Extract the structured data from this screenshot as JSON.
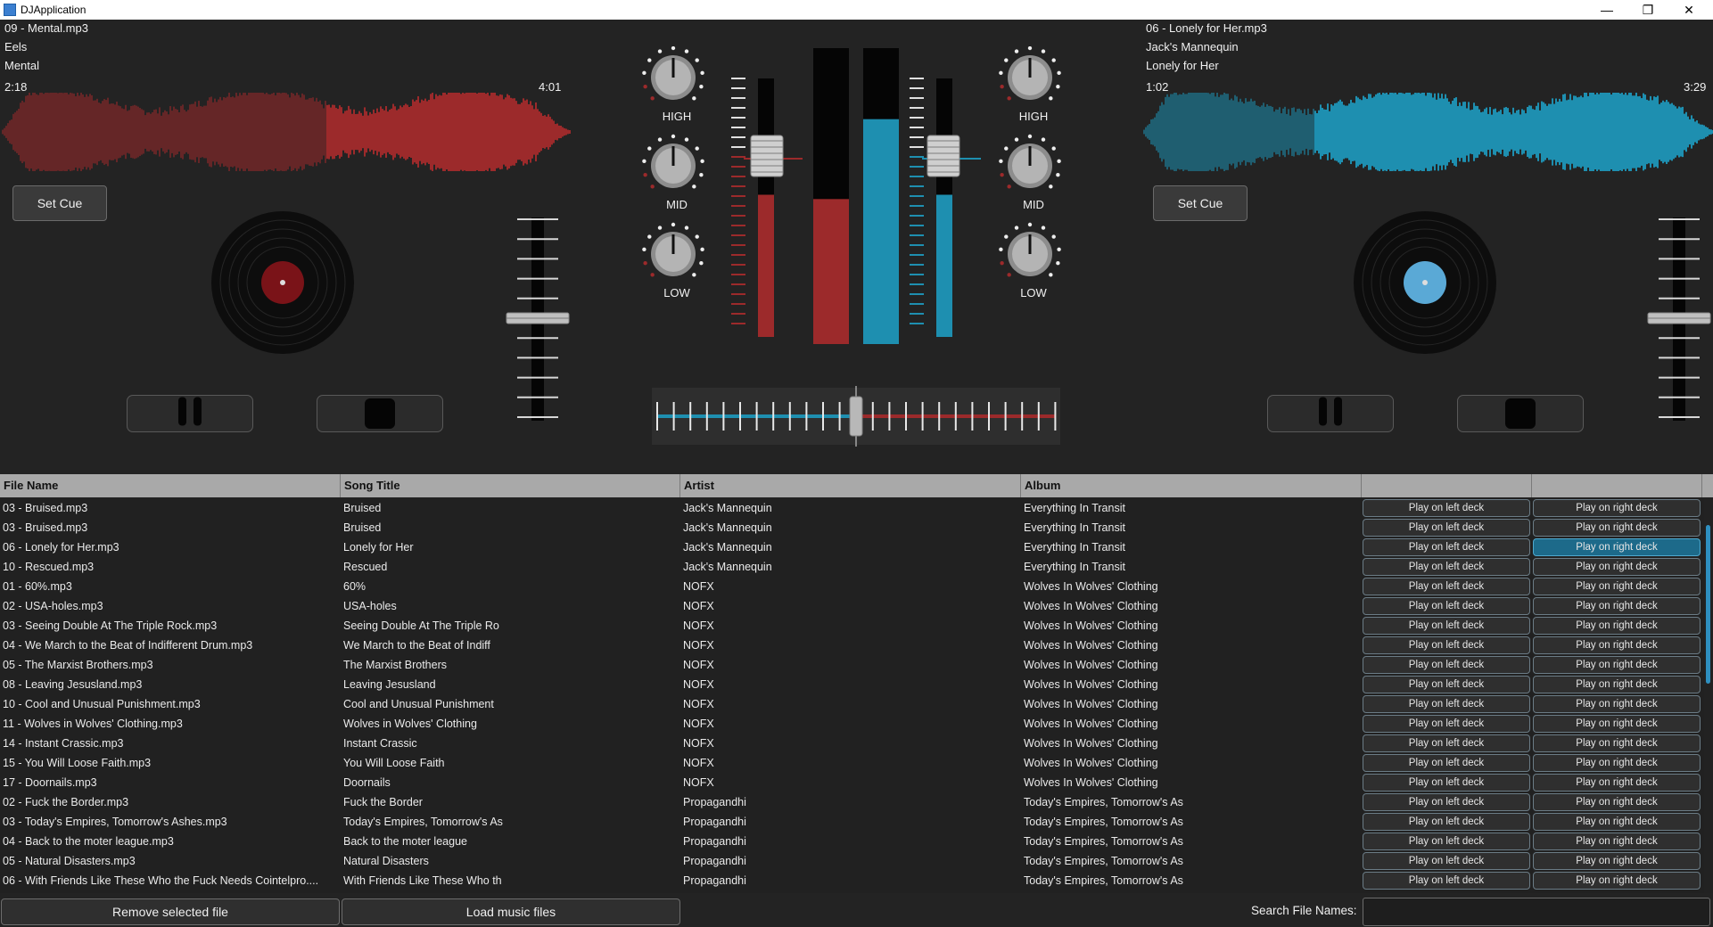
{
  "window": {
    "title": "DJApplication",
    "controls": [
      "—",
      "❐",
      "✕"
    ]
  },
  "left_deck": {
    "file": "09 - Mental.mp3",
    "artist": "Eels",
    "title": "Mental",
    "position": "2:18",
    "duration": "4:01",
    "progress": 0.57,
    "color": "#9c2a2b",
    "set_cue_label": "Set Cue",
    "pitch_level": 0.5
  },
  "right_deck": {
    "file": "06 - Lonely for Her.mp3",
    "artist": "Jack's Mannequin",
    "title": "Lonely for Her",
    "position": "1:02",
    "duration": "3:29",
    "progress": 0.3,
    "color": "#1e8fb0",
    "set_cue_label": "Set Cue",
    "pitch_level": 0.5
  },
  "mixer": {
    "knob_labels": [
      "HIGH",
      "MID",
      "LOW"
    ],
    "left_channel_level": 0.55,
    "right_channel_level": 0.55,
    "left_vu_level": 0.49,
    "right_vu_level": 0.76,
    "crossfader_position": 0.5
  },
  "library": {
    "columns": [
      "File Name",
      "Song Title",
      "Artist",
      "Album",
      "",
      ""
    ],
    "play_left_label": "Play on left deck",
    "play_right_label": "Play on right deck",
    "rows": [
      {
        "file": "03 - Bruised.mp3",
        "song": "Bruised",
        "artist": "Jack's Mannequin",
        "album": "Everything In Transit"
      },
      {
        "file": "03 - Bruised.mp3",
        "song": "Bruised",
        "artist": "Jack's Mannequin",
        "album": "Everything In Transit"
      },
      {
        "file": "06 - Lonely for Her.mp3",
        "song": "Lonely for Her",
        "artist": "Jack's Mannequin",
        "album": "Everything In Transit"
      },
      {
        "file": "10 - Rescued.mp3",
        "song": "Rescued",
        "artist": "Jack's Mannequin",
        "album": "Everything In Transit"
      },
      {
        "file": "01 - 60%.mp3",
        "song": "60%",
        "artist": "NOFX",
        "album": "Wolves In Wolves' Clothing"
      },
      {
        "file": "02 - USA-holes.mp3",
        "song": "USA-holes",
        "artist": "NOFX",
        "album": "Wolves In Wolves' Clothing"
      },
      {
        "file": "03 - Seeing Double At The Triple Rock.mp3",
        "song": "Seeing Double At The Triple Ro",
        "artist": "NOFX",
        "album": "Wolves In Wolves' Clothing"
      },
      {
        "file": "04 - We March to the Beat of Indifferent Drum.mp3",
        "song": "We March to the Beat of Indiff",
        "artist": "NOFX",
        "album": "Wolves In Wolves' Clothing"
      },
      {
        "file": "05 - The Marxist Brothers.mp3",
        "song": "The Marxist Brothers",
        "artist": "NOFX",
        "album": "Wolves In Wolves' Clothing"
      },
      {
        "file": "08 - Leaving Jesusland.mp3",
        "song": "Leaving Jesusland",
        "artist": "NOFX",
        "album": "Wolves In Wolves' Clothing"
      },
      {
        "file": "10 - Cool and Unusual Punishment.mp3",
        "song": "Cool and Unusual Punishment",
        "artist": "NOFX",
        "album": "Wolves In Wolves' Clothing"
      },
      {
        "file": "11 - Wolves in Wolves' Clothing.mp3",
        "song": "Wolves in Wolves' Clothing",
        "artist": "NOFX",
        "album": "Wolves In Wolves' Clothing"
      },
      {
        "file": "14 - Instant Crassic.mp3",
        "song": "Instant Crassic",
        "artist": "NOFX",
        "album": "Wolves In Wolves' Clothing"
      },
      {
        "file": "15 - You Will Loose Faith.mp3",
        "song": "You Will Loose Faith",
        "artist": "NOFX",
        "album": "Wolves In Wolves' Clothing"
      },
      {
        "file": "17 - Doornails.mp3",
        "song": "Doornails",
        "artist": "NOFX",
        "album": "Wolves In Wolves' Clothing"
      },
      {
        "file": "02 - Fuck the Border.mp3",
        "song": "Fuck the Border",
        "artist": "Propagandhi",
        "album": "Today's Empires, Tomorrow's As"
      },
      {
        "file": "03 - Today's Empires, Tomorrow's Ashes.mp3",
        "song": "Today's Empires, Tomorrow's As",
        "artist": "Propagandhi",
        "album": "Today's Empires, Tomorrow's As"
      },
      {
        "file": "04 - Back to the moter league.mp3",
        "song": "Back to the moter league",
        "artist": "Propagandhi",
        "album": "Today's Empires, Tomorrow's As"
      },
      {
        "file": "05 - Natural Disasters.mp3",
        "song": "Natural Disasters",
        "artist": "Propagandhi",
        "album": "Today's Empires, Tomorrow's As"
      },
      {
        "file": "06 - With Friends Like These Who the Fuck Needs Cointelpro....",
        "song": "With Friends Like These Who th",
        "artist": "Propagandhi",
        "album": "Today's Empires, Tomorrow's As"
      }
    ]
  },
  "footer": {
    "remove_label": "Remove selected file",
    "load_label": "Load music files",
    "search_label": "Search File Names:",
    "search_value": ""
  }
}
